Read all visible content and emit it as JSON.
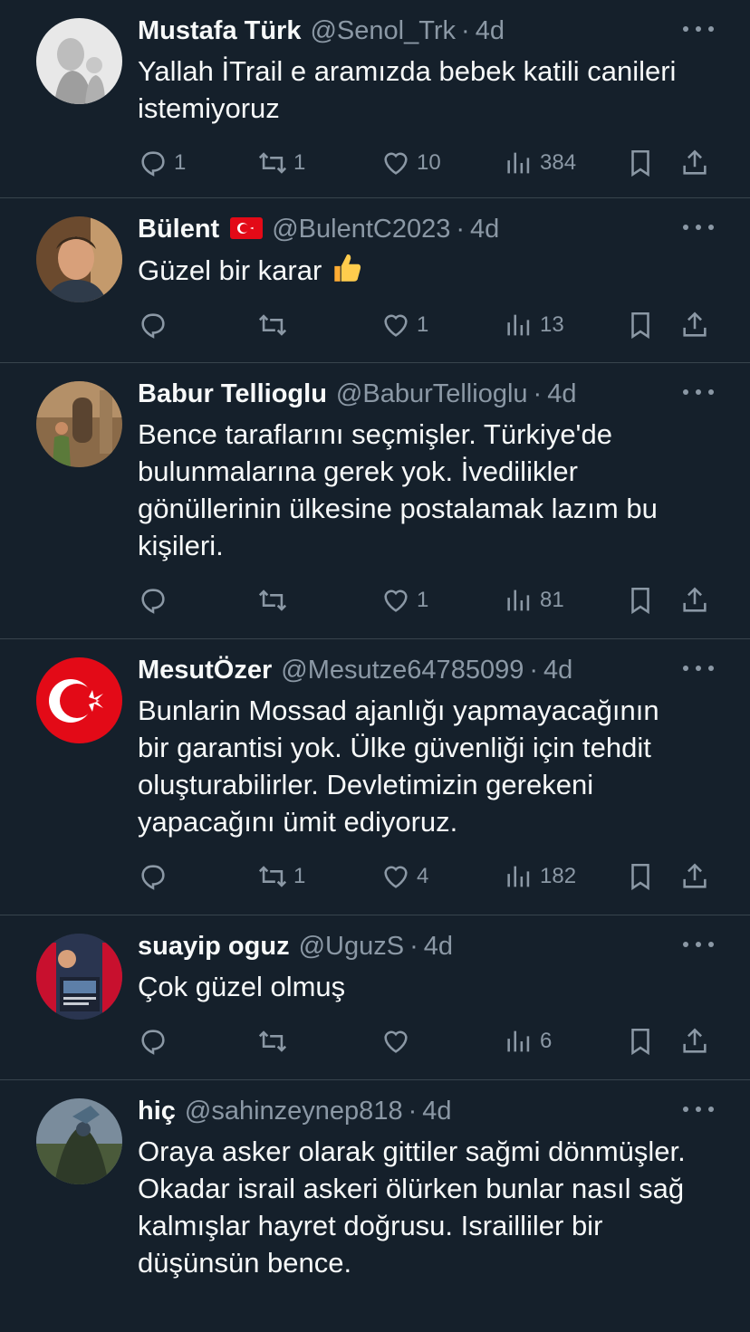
{
  "colors": {
    "background": "#15202b",
    "text": "#f7f9f9",
    "muted": "#8b98a5",
    "divider": "#38444d"
  },
  "tweets": [
    {
      "name": "Mustafa Türk",
      "handle": "@Senol_Trk",
      "separator": "·",
      "time": "4d",
      "text": "Yallah İTrail e aramızda bebek katili canileri istemiyoruz",
      "replies": "1",
      "retweets": "1",
      "likes": "10",
      "views": "384"
    },
    {
      "name": "Bülent",
      "handle": "@BulentC2023",
      "separator": "·",
      "time": "4d",
      "text": "Güzel bir karar",
      "replies": "",
      "retweets": "",
      "likes": "1",
      "views": "13"
    },
    {
      "name": "Babur Tellioglu",
      "handle": "@BaburTellioglu",
      "separator": "·",
      "time": "4d",
      "text": "Bence taraflarını seçmişler. Türkiye'de bulunmalarına gerek yok. İvedilikler gönüllerinin ülkesine postalamak lazım bu kişileri.",
      "replies": "",
      "retweets": "",
      "likes": "1",
      "views": "81"
    },
    {
      "name": "MesutÖzer",
      "handle": "@Mesutze64785099",
      "separator": "·",
      "time": "4d",
      "text": "Bunlarin Mossad ajanlığı yapmayacağının bir garantisi yok. Ülke güvenliği için tehdit oluşturabilirler. Devletimizin gerekeni yapacağını ümit ediyoruz.",
      "replies": "",
      "retweets": "1",
      "likes": "4",
      "views": "182"
    },
    {
      "name": "suayip oguz",
      "handle": "@UguzS",
      "separator": "·",
      "time": "4d",
      "text": "Çok güzel olmuş",
      "replies": "",
      "retweets": "",
      "likes": "",
      "views": "6"
    },
    {
      "name": "hiç",
      "handle": "@sahinzeynep818",
      "separator": "·",
      "time": "4d",
      "text": "Oraya asker olarak gittiler sağmi dönmüşler. Okadar israil askeri ölürken bunlar nasıl sağ kalmışlar hayret doğrusu. Israilliler bir düşünsün bence.",
      "replies": "",
      "retweets": "",
      "likes": "",
      "views": ""
    }
  ],
  "icons": {
    "reply": "reply-icon",
    "retweet": "retweet-icon",
    "like": "like-icon",
    "views": "views-icon",
    "bookmark": "bookmark-icon",
    "share": "share-icon",
    "more": "more-icon",
    "flag": "turkey-flag-emoji",
    "thumb": "thumbs-up-emoji"
  }
}
